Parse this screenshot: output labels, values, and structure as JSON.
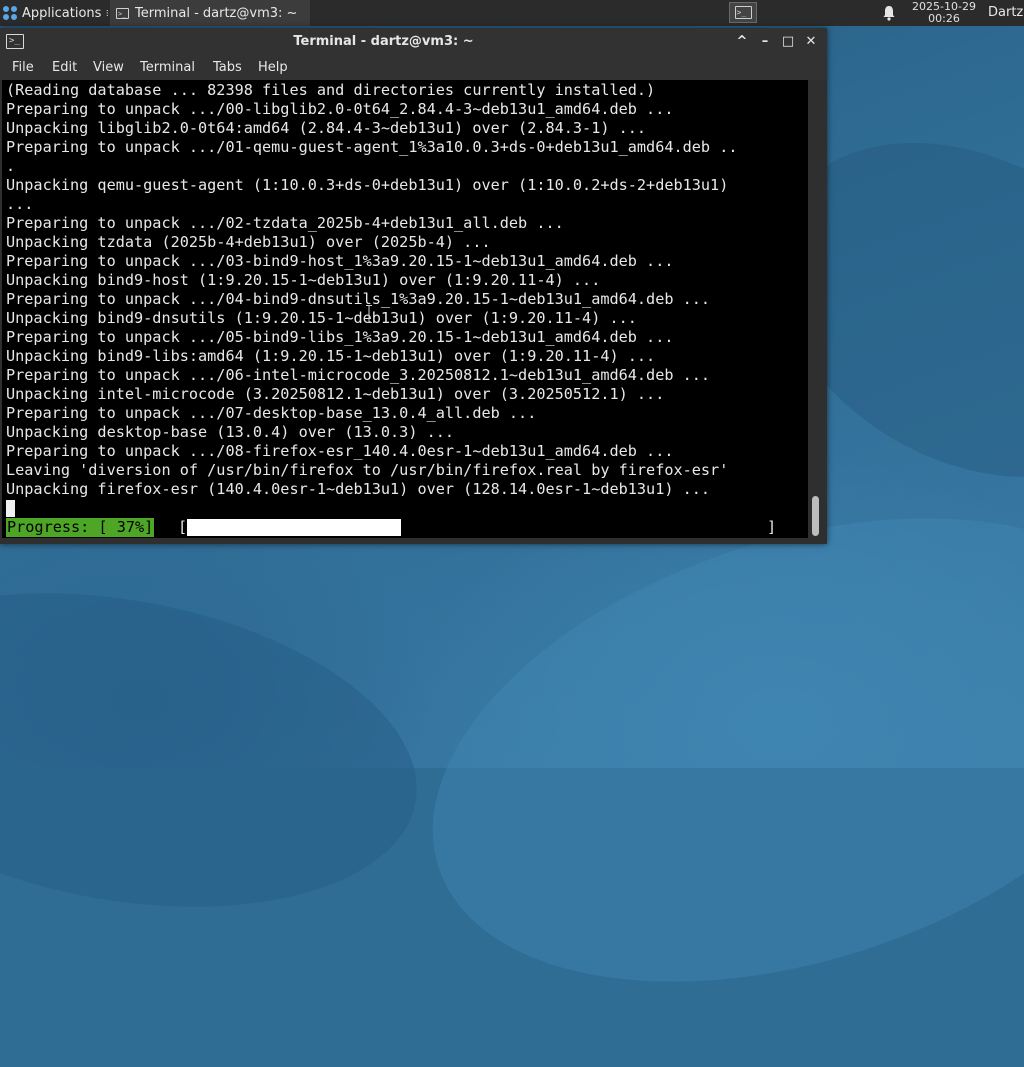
{
  "panel": {
    "applications_label": "Applications",
    "task_title": "Terminal - dartz@vm3: ~",
    "clock_date": "2025-10-29",
    "clock_time": "00:26",
    "user_label": "Dartz"
  },
  "window": {
    "title": "Terminal - dartz@vm3: ~",
    "controls": {
      "shade": "^",
      "minimize": "–",
      "maximize": "□",
      "close": "✕"
    },
    "menu": [
      "File",
      "Edit",
      "View",
      "Terminal",
      "Tabs",
      "Help"
    ]
  },
  "terminal": {
    "lines": [
      "(Reading database ... 82398 files and directories currently installed.)",
      "Preparing to unpack .../00-libglib2.0-0t64_2.84.4-3~deb13u1_amd64.deb ...",
      "Unpacking libglib2.0-0t64:amd64 (2.84.4-3~deb13u1) over (2.84.3-1) ...",
      "Preparing to unpack .../01-qemu-guest-agent_1%3a10.0.3+ds-0+deb13u1_amd64.deb ..",
      ".",
      "Unpacking qemu-guest-agent (1:10.0.3+ds-0+deb13u1) over (1:10.0.2+ds-2+deb13u1)",
      "...",
      "Preparing to unpack .../02-tzdata_2025b-4+deb13u1_all.deb ...",
      "Unpacking tzdata (2025b-4+deb13u1) over (2025b-4) ...",
      "Preparing to unpack .../03-bind9-host_1%3a9.20.15-1~deb13u1_amd64.deb ...",
      "Unpacking bind9-host (1:9.20.15-1~deb13u1) over (1:9.20.11-4) ...",
      "Preparing to unpack .../04-bind9-dnsutils_1%3a9.20.15-1~deb13u1_amd64.deb ...",
      "Unpacking bind9-dnsutils (1:9.20.15-1~deb13u1) over (1:9.20.11-4) ...",
      "Preparing to unpack .../05-bind9-libs_1%3a9.20.15-1~deb13u1_amd64.deb ...",
      "Unpacking bind9-libs:amd64 (1:9.20.15-1~deb13u1) over (1:9.20.11-4) ...",
      "Preparing to unpack .../06-intel-microcode_3.20250812.1~deb13u1_amd64.deb ...",
      "Unpacking intel-microcode (3.20250812.1~deb13u1) over (3.20250512.1) ...",
      "Preparing to unpack .../07-desktop-base_13.0.4_all.deb ...",
      "Unpacking desktop-base (13.0.4) over (13.0.3) ...",
      "Preparing to unpack .../08-firefox-esr_140.4.0esr-1~deb13u1_amd64.deb ...",
      "Leaving 'diversion of /usr/bin/firefox to /usr/bin/firefox.real by firefox-esr'",
      "Unpacking firefox-esr (140.4.0esr-1~deb13u1) over (128.14.0esr-1~deb13u1) ..."
    ],
    "progress_label": "Progress: [ 37%]",
    "progress_fraction": 0.37,
    "bracket_open": "[",
    "bracket_close": "]"
  },
  "colors": {
    "progress_green": "#4ea626",
    "terminal_bg": "#000000",
    "terminal_fg": "#e8e8e8"
  },
  "icons": [
    "applications-menu-icon",
    "terminal-icon",
    "bell-icon",
    "ibeam-cursor-icon"
  ]
}
